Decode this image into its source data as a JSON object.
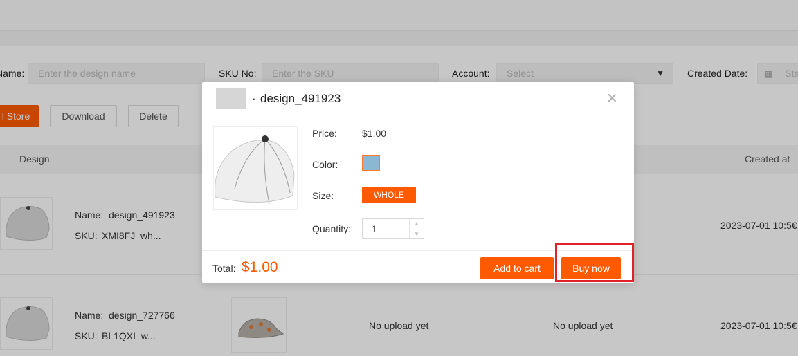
{
  "filters": {
    "name_label": "Name:",
    "name_placeholder": "Enter the design name",
    "sku_label": "SKU No:",
    "sku_placeholder": "Enter the SKU",
    "account_label": "Account:",
    "account_placeholder": "Select",
    "created_label": "Created Date:",
    "created_placeholder": "Sta"
  },
  "actions": {
    "store_label": "l Store",
    "download_label": "Download",
    "delete_label": "Delete"
  },
  "table": {
    "headers": {
      "design": "Design",
      "created": "Created at"
    },
    "rows": [
      {
        "name_label": "Name:",
        "name": "design_491923",
        "sku_label": "SKU:",
        "sku": "XMI8FJ_wh...",
        "created": "2023-07-01 10:5€"
      },
      {
        "name_label": "Name:",
        "name": "design_727766",
        "sku_label": "SKU:",
        "sku": "BL1QXI_w...",
        "status1": "No upload yet",
        "status2": "No upload yet",
        "created": "2023-07-01 10:5€"
      }
    ]
  },
  "modal": {
    "title": "design_491923",
    "title_prefix": "·",
    "price_label": "Price:",
    "price": "$1.00",
    "color_label": "Color:",
    "color_value": "#8ab8d2",
    "size_label": "Size:",
    "size_value": "WHOLE",
    "quantity_label": "Quantity:",
    "quantity": "1",
    "total_label": "Total:",
    "total": "$1.00",
    "add_to_cart": "Add to cart",
    "buy_now": "Buy now"
  },
  "colors": {
    "accent": "#ff5a00",
    "highlight": "#e0202a"
  }
}
